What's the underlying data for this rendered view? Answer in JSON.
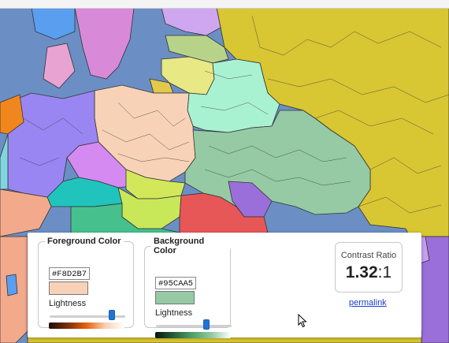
{
  "map": {
    "description_colors": {
      "sea": "#6b8fc4",
      "russia": "#d9c633",
      "poland": "#f8d2b7",
      "ukraine": "#95caa5",
      "belarus": "#a8f2d2",
      "germany": "#9a86f2",
      "czechia": "#d58af2",
      "hungary": "#20c4bd",
      "romania": "#e85757",
      "balkans": "#c8e85a",
      "moldova": "#9b6fd9",
      "sweden": "#d88ad8",
      "norway": "#5a9ef0",
      "baltics_north": "#cfa6f0",
      "latvia": "#b7d38a",
      "lithuania": "#e8e884",
      "kaliningrad": "#e3c84a",
      "netherlands": "#f0871e",
      "france": "#f3a98b",
      "slovenia_croatia": "#46c08c",
      "turkey": "#9b6fd9"
    }
  },
  "panel": {
    "foreground": {
      "legend": "Foreground Color",
      "hex": "#F8D2B7",
      "lightness_label": "Lightness",
      "lightness_value": 0.82,
      "gradient_colors": [
        "#1a0e06",
        "#7a2f09",
        "#e8620c",
        "#f8d2b7",
        "#ffffff"
      ]
    },
    "background": {
      "legend": "Background Color",
      "hex": "#95CAA5",
      "lightness_label": "Lightness",
      "lightness_value": 0.67,
      "gradient_colors": [
        "#0a140d",
        "#2a5e3a",
        "#4ea46a",
        "#95caa5",
        "#ffffff"
      ]
    },
    "contrast": {
      "label": "Contrast Ratio",
      "ratio": "1.32",
      "suffix": ":1"
    },
    "permalink": "permalink"
  }
}
